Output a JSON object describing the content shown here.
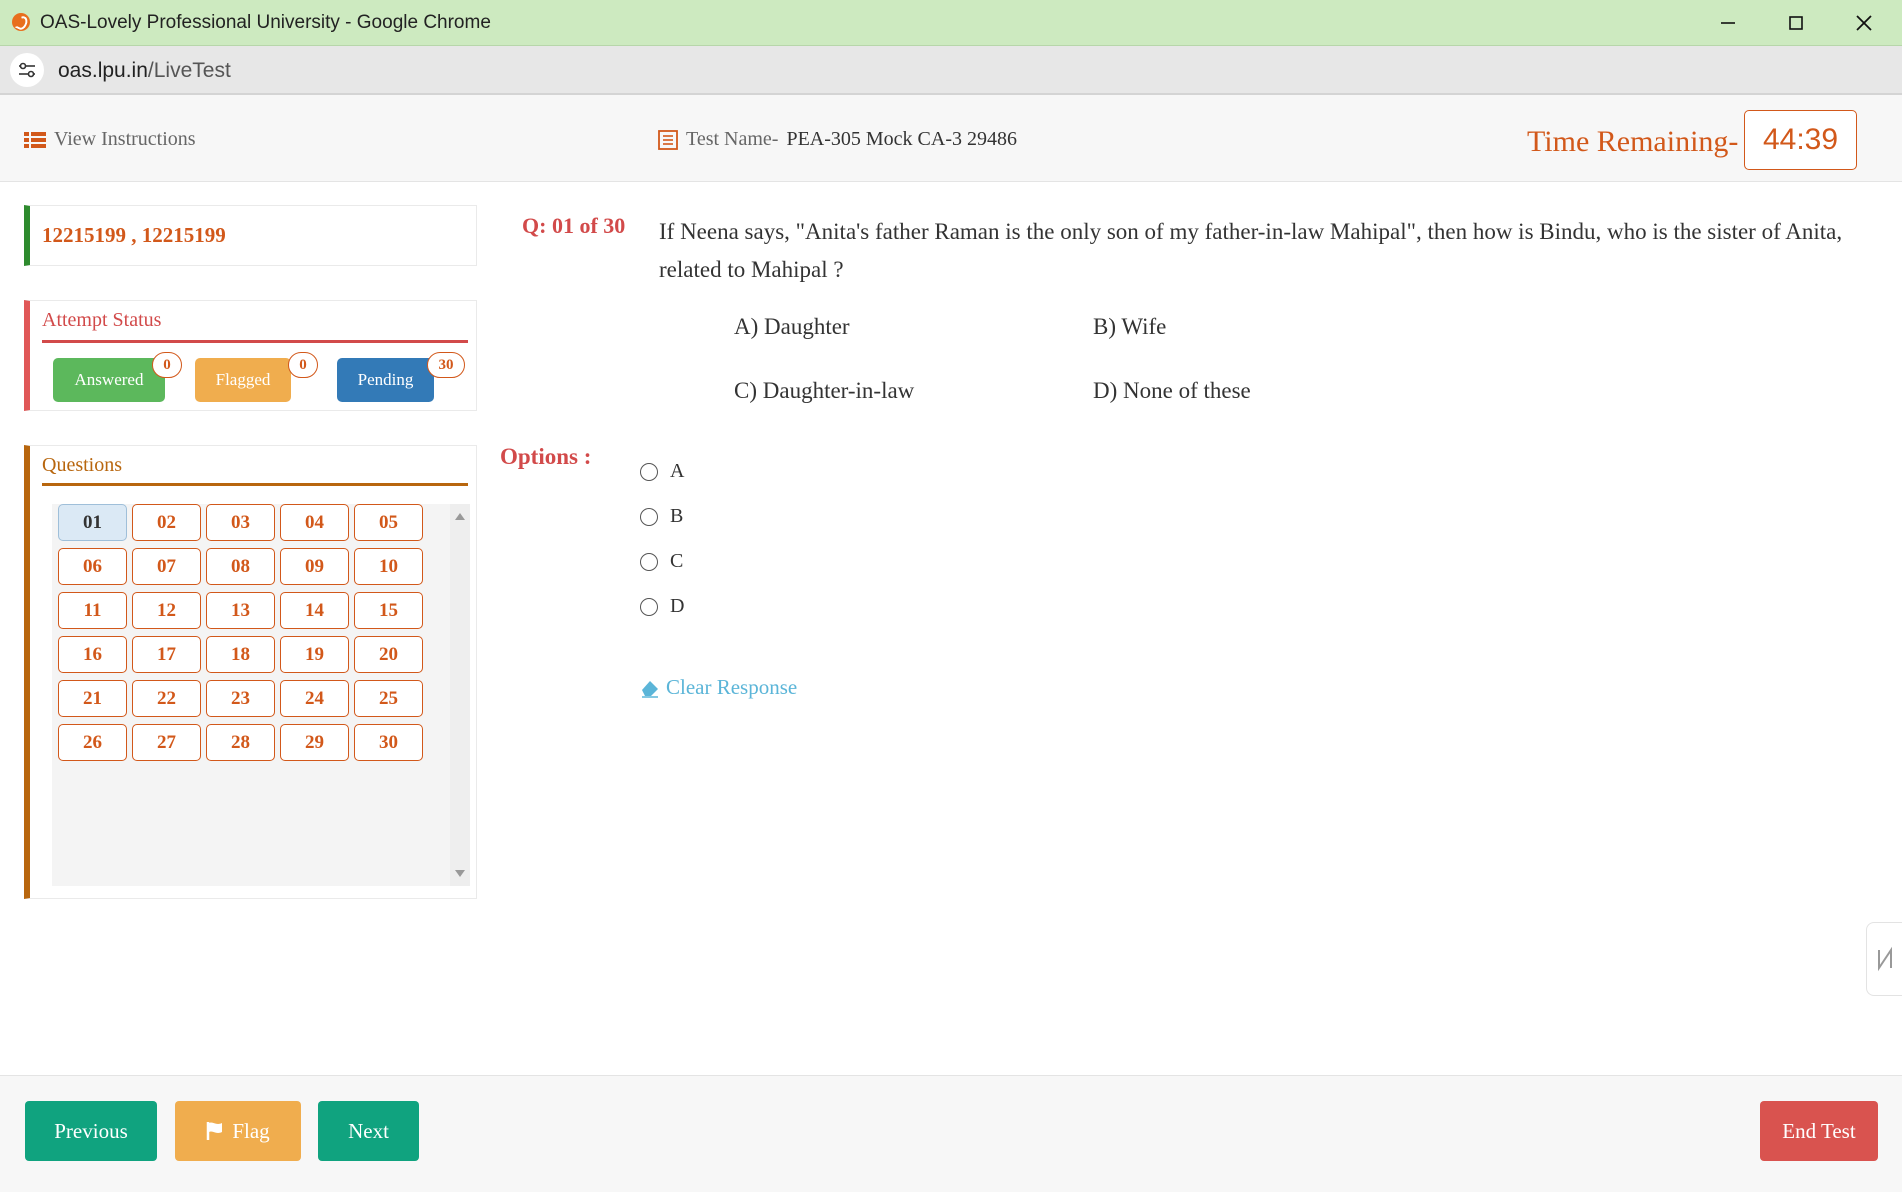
{
  "window": {
    "title": "OAS-Lovely Professional University - Google Chrome",
    "minimize_glyph": "—",
    "maximize_glyph": "☐",
    "close_glyph": "✕"
  },
  "address": {
    "domain": "oas.lpu.in",
    "path": "/LiveTest"
  },
  "header": {
    "view_instructions": "View Instructions",
    "test_name_label": "Test Name-",
    "test_name": "PEA-305 Mock CA-3 29486",
    "time_label": "Time Remaining-",
    "time_value": "44:39"
  },
  "student": {
    "id": "12215199 , 12215199"
  },
  "attempt_status": {
    "title": "Attempt Status",
    "answered": {
      "label": "Answered",
      "count": "0",
      "color": "#5cb85c"
    },
    "flagged": {
      "label": "Flagged",
      "count": "0",
      "color": "#f0ad4e"
    },
    "pending": {
      "label": "Pending",
      "count": "30",
      "color": "#337ab7"
    }
  },
  "questions_panel": {
    "title": "Questions",
    "numbers": [
      "01",
      "02",
      "03",
      "04",
      "05",
      "06",
      "07",
      "08",
      "09",
      "10",
      "11",
      "12",
      "13",
      "14",
      "15",
      "16",
      "17",
      "18",
      "19",
      "20",
      "21",
      "22",
      "23",
      "24",
      "25",
      "26",
      "27",
      "28",
      "29",
      "30"
    ],
    "current": "01"
  },
  "question": {
    "number": "Q: 01 of 30",
    "text": "If Neena says, \"Anita's father Raman is the only son of my father-in-law Mahipal\", then how is Bindu, who is the sister of Anita, related to Mahipal ?",
    "choices": {
      "a": "A) Daughter",
      "b": "B) Wife",
      "c": "C) Daughter-in-law",
      "d": "D) None of these"
    }
  },
  "options": {
    "label": "Options :",
    "items": [
      "A",
      "B",
      "C",
      "D"
    ],
    "clear_response": "Clear Response"
  },
  "footer": {
    "previous": "Previous",
    "flag": "Flag",
    "next": "Next",
    "end_test": "End Test"
  },
  "colors": {
    "accent_orange": "#d2581a",
    "success_green": "#10a37f",
    "warning_orange": "#f0ad4e",
    "danger_red": "#d9534f",
    "link_blue": "#5bb5d8"
  }
}
